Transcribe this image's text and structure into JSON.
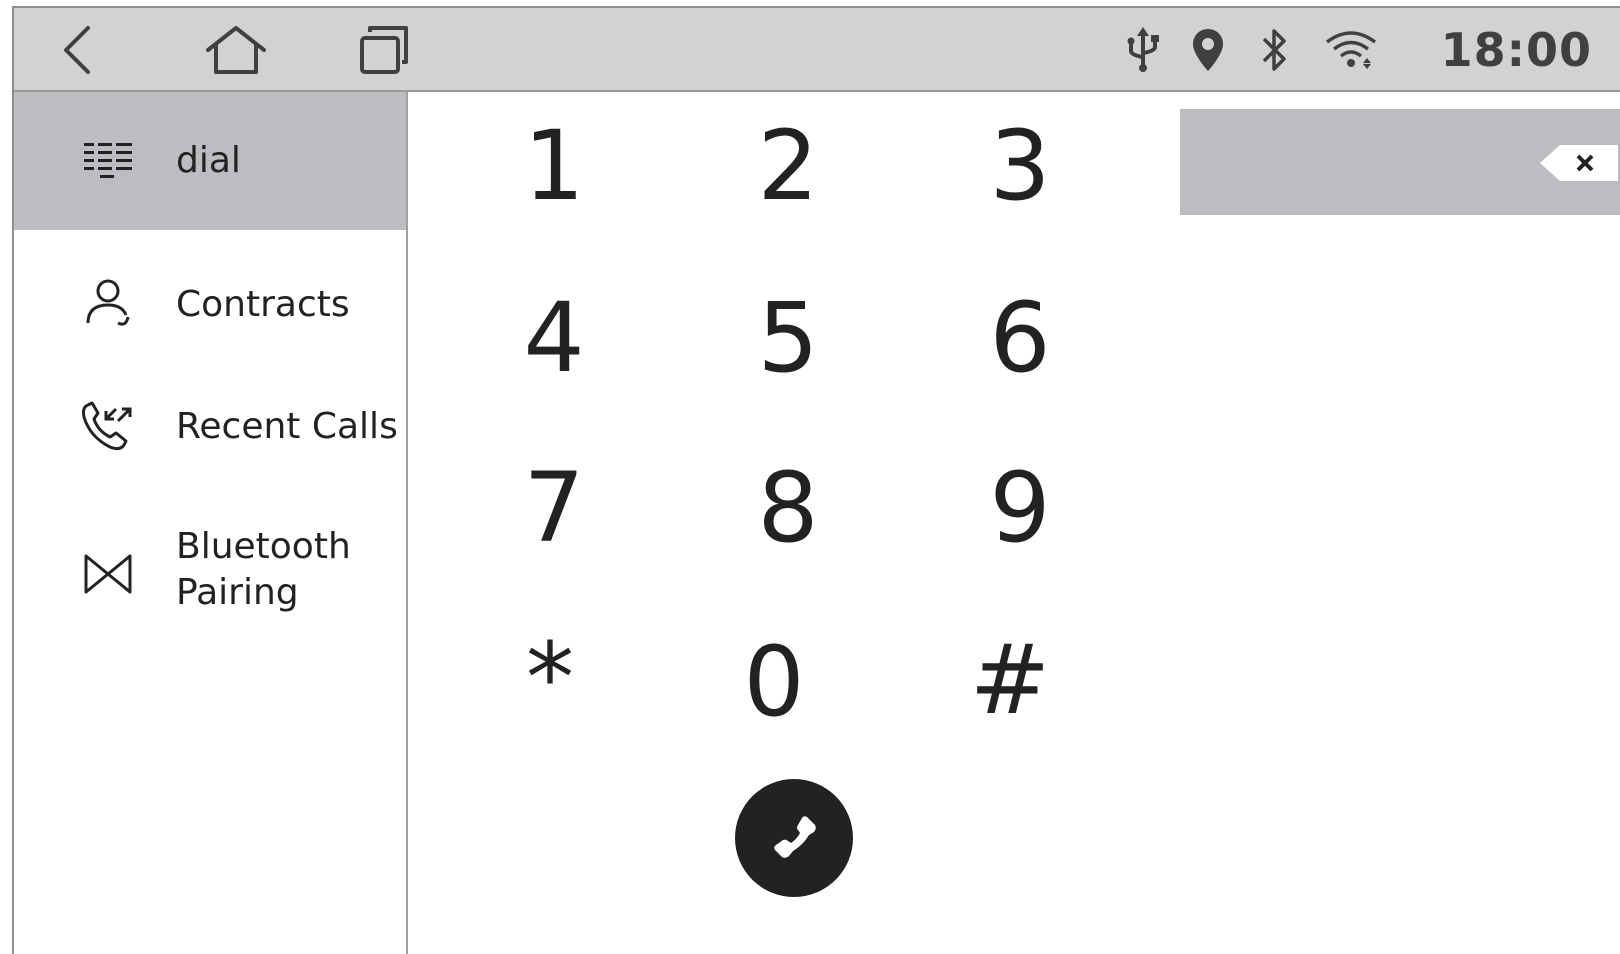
{
  "status_bar": {
    "time": "18:00",
    "nav": {
      "back": "back-icon",
      "home": "home-icon",
      "recents": "recents-icon"
    },
    "indicators": [
      "usb-icon",
      "location-icon",
      "bluetooth-icon",
      "wifi-icon"
    ]
  },
  "sidebar": {
    "items": [
      {
        "label": "dial",
        "icon": "dialpad-icon",
        "active": true
      },
      {
        "label": "Contracts",
        "icon": "contact-icon",
        "active": false
      },
      {
        "label": "Recent Calls",
        "icon": "recent-calls-icon",
        "active": false
      },
      {
        "label": "Bluetooth Pairing",
        "label_lines": [
          "Bluetooth",
          "Pairing"
        ],
        "icon": "bluetooth-pairing-icon",
        "active": false
      }
    ]
  },
  "keypad": {
    "keys": [
      "1",
      "2",
      "3",
      "4",
      "5",
      "6",
      "7",
      "8",
      "9",
      "*",
      "0",
      "#"
    ]
  },
  "number_display": {
    "value": "",
    "clear_icon": "backspace-icon"
  },
  "call_button": {
    "icon": "phone-icon"
  },
  "colors": {
    "status_bar_bg": "#d1d2d4",
    "active_item_bg": "#bcbdc0",
    "display_bg": "#bcbdc0",
    "call_button_bg": "#222222",
    "text": "#222222"
  }
}
